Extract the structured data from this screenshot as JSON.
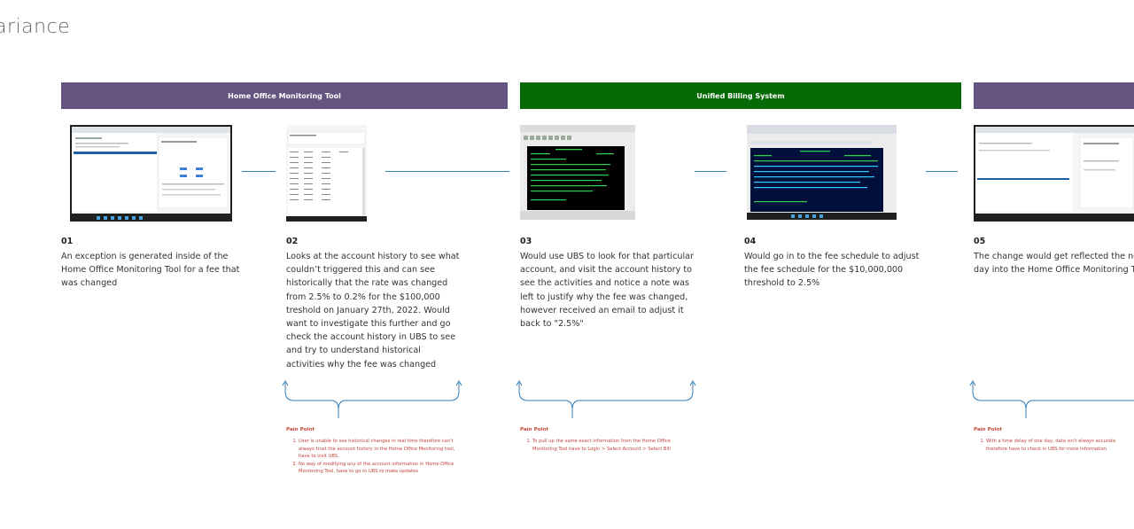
{
  "page": {
    "title": "ariance"
  },
  "bands": [
    {
      "label": "Home Office Monitoring Tool",
      "color": "#65547f"
    },
    {
      "label": "Unified Billing System",
      "color": "#066b06"
    },
    {
      "label": ""
    }
  ],
  "steps": [
    {
      "num": "01",
      "text": "An exception is generated inside of the Home Office Monitoring Tool for a fee that was changed"
    },
    {
      "num": "02",
      "text": "Looks at the account history to see what couldn’t triggered this and can see historically that the rate was changed from 2.5% to 0.2% for the $100,000 treshold on January 27th, 2022. Would want to investigate this further and go check the account history in UBS to see and try to understand historical activities why the fee was changed"
    },
    {
      "num": "03",
      "text": "Would use UBS to look for that particular account, and visit the account history to see the activities and notice a note was left to justify why the fee was changed, however received an email to adjust it back to \"2.5%\""
    },
    {
      "num": "04",
      "text": "Would go in to the fee schedule to adjust  the  fee schedule for the $10,000,000 threshold to 2.5%"
    },
    {
      "num": "05",
      "text": "The change would get reflected the next day into the Home Office Monitoring Tool"
    }
  ],
  "pain_points": [
    {
      "title": "Pain Point",
      "items": [
        "User is unable to see historical changes in real time therefore can't always trust the account history in the Home Office Monitoring tool, have to visit UBS.",
        "No way of modifying any of the account information in Home Office Monitoring Tool, have to go to UBS to make updates"
      ]
    },
    {
      "title": "Pain Point",
      "items": [
        "To pull up the same exact information from the Home Office Monitoring Tool have to Login > Select Account > Select Bill"
      ]
    },
    {
      "title": "Pain Point",
      "items": [
        "With a time delay of one day, data isn't always accurate therefore have to check in UBS for more information"
      ]
    }
  ],
  "colors": {
    "accent": "#2f7fb8",
    "pain": "#c0453b",
    "purple": "#65547f",
    "green": "#066b06"
  }
}
